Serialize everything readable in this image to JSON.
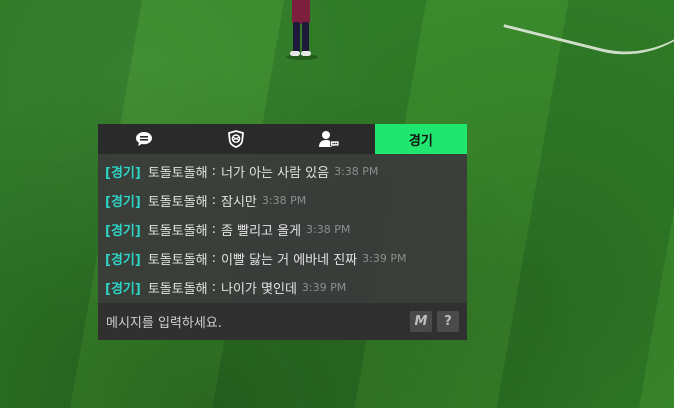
{
  "chat": {
    "tabs": [
      {
        "icon": "speech-bubble-icon",
        "label": ""
      },
      {
        "icon": "club-shield-icon",
        "label": ""
      },
      {
        "icon": "user-chat-icon",
        "label": ""
      },
      {
        "icon": "",
        "label": "경기"
      }
    ],
    "active_tab": 3,
    "messages": [
      {
        "channel": "[경기]",
        "sender": "토돌토돌해",
        "separator": ":",
        "text": "너가 아는 사람 있음",
        "time": "3:38 PM"
      },
      {
        "channel": "[경기]",
        "sender": "토돌토돌해",
        "separator": ":",
        "text": "잠시만",
        "time": "3:38 PM"
      },
      {
        "channel": "[경기]",
        "sender": "토돌토돌해",
        "separator": ":",
        "text": "좀 빨리고 올게",
        "time": "3:38 PM"
      },
      {
        "channel": "[경기]",
        "sender": "토돌토돌해",
        "separator": ":",
        "text": "이빨 닳는 거 에바네 진짜",
        "time": "3:39 PM"
      },
      {
        "channel": "[경기]",
        "sender": "토돌토돌해",
        "separator": ":",
        "text": "나이가 몇인데",
        "time": "3:39 PM"
      }
    ],
    "input": {
      "placeholder": "메시지를 입력하세요.",
      "macro_label": "M",
      "help_label": "?"
    }
  },
  "colors": {
    "active_tab": "#1ee66e",
    "channel_tag": "#2ed3c6",
    "panel_bg": "#3a3a3a",
    "pitch_green": "#347f29"
  }
}
